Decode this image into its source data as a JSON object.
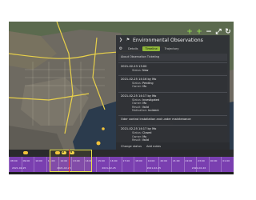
{
  "map": {
    "controls": [
      {
        "name": "add-observation-icon",
        "glyph": "+"
      },
      {
        "name": "zoom-in-icon",
        "glyph": "+"
      },
      {
        "name": "zoom-out-icon",
        "glyph": "−"
      },
      {
        "name": "fullscreen-icon",
        "glyph": "⤢"
      },
      {
        "name": "refresh-icon",
        "glyph": "↻"
      }
    ],
    "colors": {
      "sea": "#2a3a4c",
      "land": "#6f6b62",
      "roads": "#e8d04a",
      "marker": "#f2c33a"
    }
  },
  "panel": {
    "title": "Environmental Observations",
    "tabs": [
      "Details",
      "Timeline",
      "Trajectory"
    ],
    "active_tab": "Timeline",
    "section_label": "About Observation Ticketing",
    "entries": [
      {
        "stamp": "2021-02-23 13:00",
        "rows": [
          {
            "k": "Status:",
            "v": "New"
          }
        ]
      },
      {
        "stamp": "2021-02-25 14:16 by Mo",
        "rows": [
          {
            "k": "Status:",
            "v": "Pending"
          },
          {
            "k": "Owner:",
            "v": "Mo"
          }
        ]
      },
      {
        "stamp": "2021-02-25 14:17 by Mo",
        "rows": [
          {
            "k": "Status:",
            "v": "Investigated"
          },
          {
            "k": "Owner:",
            "v": "Mo"
          },
          {
            "k": "Result:",
            "v": "Valid"
          },
          {
            "k": "Motivation:",
            "v": "Incident"
          }
        ]
      },
      {
        "stamp": "Oder control installation and under maintenance",
        "rows": []
      },
      {
        "stamp": "2021-02-25 14:17 by Mo",
        "rows": [
          {
            "k": "Status:",
            "v": "Closed"
          },
          {
            "k": "Owner:",
            "v": "Mo"
          },
          {
            "k": "Result:",
            "v": "Valid"
          },
          {
            "k": "Motivation:",
            "v": "Incident"
          }
        ]
      }
    ],
    "footer": {
      "change_status": "Change status",
      "add_notes": "Add notes"
    }
  },
  "timeline": {
    "labels_top": [
      "08:00",
      "09:00",
      "10:00",
      "11:00",
      "12:00",
      "13:00",
      "14:00",
      "15:00",
      "16:00",
      "17:00",
      "18:00",
      "19:00",
      "20:00",
      "21:00",
      "22:00",
      "23:00",
      "00:00",
      "01:00"
    ],
    "labels_bottom": [
      "2021-02-25",
      "2021-02-25",
      "2021-02-25",
      "2021-02-25",
      "2021-02-26"
    ],
    "event_badges": [
      "2",
      "5"
    ]
  }
}
